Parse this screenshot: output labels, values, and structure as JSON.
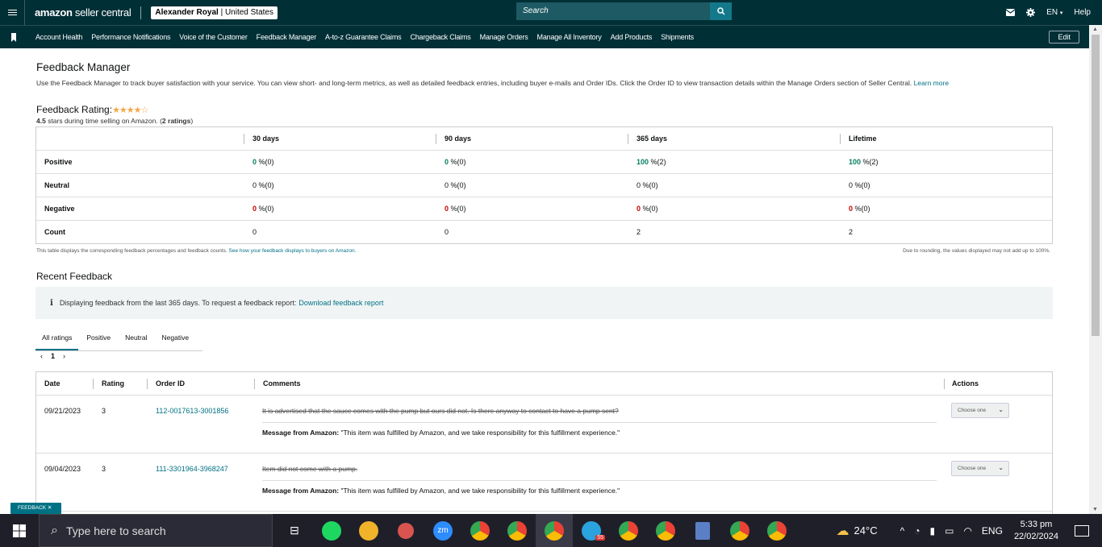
{
  "topbar": {
    "logo_a": "amazon",
    "logo_b": " seller central",
    "account_name": "Alexander Royal",
    "account_region": " | United States",
    "search_placeholder": "Search",
    "lang": "EN",
    "help": "Help"
  },
  "nav": {
    "items": [
      "Account Health",
      "Performance Notifications",
      "Voice of the Customer",
      "Feedback Manager",
      "A-to-z Guarantee Claims",
      "Chargeback Claims",
      "Manage Orders",
      "Manage All Inventory",
      "Add Products",
      "Shipments"
    ],
    "edit": "Edit"
  },
  "page": {
    "title": "Feedback Manager",
    "intro": "Use the Feedback Manager to track buyer satisfaction with your service. You can view short- and long-term metrics, as well as detailed feedback entries, including buyer e-mails and Order IDs. Click the Order ID to view transaction details within the Manage Orders section of Seller Central.",
    "learn_more": "Learn more",
    "rating_label": "Feedback Rating:",
    "stars": "★★★★☆",
    "rating_value": "4.5",
    "rating_text_a": " stars during time selling on Amazon. (",
    "rating_count": "2 ratings",
    "rating_text_b": ")"
  },
  "metrics": {
    "periods": [
      "30 days",
      "90 days",
      "365 days",
      "Lifetime"
    ],
    "rows": [
      {
        "label": "Positive",
        "values": [
          "0",
          "0",
          "100",
          "100"
        ],
        "suffix": [
          " %(0)",
          " %(0)",
          " %(2)",
          " %(2)"
        ]
      },
      {
        "label": "Neutral",
        "values": [
          "0",
          "0",
          "0",
          "0"
        ],
        "suffix": [
          " %(0)",
          " %(0)",
          " %(0)",
          " %(0)"
        ]
      },
      {
        "label": "Negative",
        "values": [
          "0",
          "0",
          "0",
          "0"
        ],
        "suffix": [
          " %(0)",
          " %(0)",
          " %(0)",
          " %(0)"
        ]
      },
      {
        "label": "Count",
        "values": [
          "0",
          "0",
          "2",
          "2"
        ]
      }
    ],
    "footnote_a": "This table displays the corresponding feedback percentages and feedback counts. ",
    "footnote_link": "See how your feedback displays to buyers on Amazon.",
    "footnote_right": "Due to rounding, the values displayed may not add up to 100%.",
    "positive_color": "#067d62",
    "negative_color": "#c40000"
  },
  "recent": {
    "title": "Recent Feedback",
    "info_text": "Displaying feedback from the last 365 days. To request a feedback report: ",
    "info_link": "Download feedback report",
    "tabs": [
      "All ratings",
      "Positive",
      "Neutral",
      "Negative"
    ],
    "page": "1",
    "columns": [
      "Date",
      "Rating",
      "Order ID",
      "Comments",
      "Actions"
    ],
    "rows": [
      {
        "date": "09/21/2023",
        "rating": "3",
        "order_id": "112-0017613-3001856",
        "comment": "It is advertised that the sauce comes with the pump but ours did not. Is there anyway to contact to have a pump sent?",
        "msg_label": "Message from Amazon:",
        "msg": " \"This item was fulfilled by Amazon, and we take responsibility for this fulfillment experience.\"",
        "action": "Choose one"
      },
      {
        "date": "09/04/2023",
        "rating": "3",
        "order_id": "111-3301964-3968247",
        "comment": "Item did not come with a pump.",
        "msg_label": "Message from Amazon:",
        "msg": " \"This item was fulfilled by Amazon, and we take responsibility for this fulfillment experience.\"",
        "action": "Choose one"
      }
    ]
  },
  "feedback_tag": "FEEDBACK",
  "taskbar": {
    "search": "Type here to search",
    "temp": "24°C",
    "lang": "ENG",
    "time": "5:33 pm",
    "date": "22/02/2024",
    "telegram_badge": "55"
  }
}
